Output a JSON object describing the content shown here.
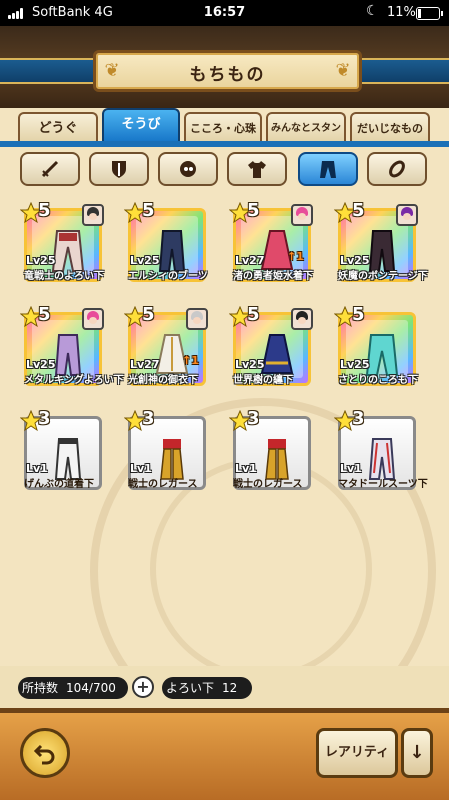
{
  "status": {
    "carrier": "SoftBank  4G",
    "time": "16:57",
    "battery": "11%"
  },
  "header": {
    "title": "もちもの"
  },
  "tabs": [
    {
      "label": "どうぐ"
    },
    {
      "label": "そうび"
    },
    {
      "label": "こころ・心珠"
    },
    {
      "label": "みんなとスタンプ"
    },
    {
      "label": "だいじなもの"
    }
  ],
  "filters": [
    "sword-icon",
    "shield-icon",
    "helmet-icon",
    "shirt-icon",
    "pants-icon",
    "accessory-icon"
  ],
  "items": [
    {
      "rarity": "5",
      "level": "Lv25",
      "name": "竜戦士のよろい下",
      "upgrade": ""
    },
    {
      "rarity": "5",
      "level": "Lv25",
      "name": "エルシィのブーツ",
      "upgrade": ""
    },
    {
      "rarity": "5",
      "level": "Lv27",
      "name": "渚の勇者姫水着下",
      "upgrade": "1"
    },
    {
      "rarity": "5",
      "level": "Lv25",
      "name": "妖魔のボンテージ下",
      "upgrade": ""
    },
    {
      "rarity": "5",
      "level": "Lv25",
      "name": "メタルキングよろい下",
      "upgrade": ""
    },
    {
      "rarity": "5",
      "level": "Lv27",
      "name": "光創神の御衣下",
      "upgrade": "1"
    },
    {
      "rarity": "5",
      "level": "Lv25",
      "name": "世界樹の纏下",
      "upgrade": ""
    },
    {
      "rarity": "5",
      "level": "Lv25",
      "name": "さとりのころも下",
      "upgrade": ""
    },
    {
      "rarity": "3",
      "level": "Lv1",
      "name": "げんぶの道着下",
      "upgrade": ""
    },
    {
      "rarity": "3",
      "level": "Lv1",
      "name": "戦士のレガース",
      "upgrade": ""
    },
    {
      "rarity": "3",
      "level": "Lv1",
      "name": "戦士のレガース",
      "upgrade": ""
    },
    {
      "rarity": "3",
      "level": "Lv1",
      "name": "マタドールスーツ下",
      "upgrade": ""
    }
  ],
  "inventory": {
    "label": "所持数",
    "count": "104/700",
    "plus": "+"
  },
  "category": {
    "label": "よろい下",
    "count": "12"
  },
  "footer": {
    "sort_label": "レアリティ",
    "order_icon": "↓"
  },
  "colors": {
    "tab_active": "#1776c8",
    "rarity5_border": "#f7c337",
    "rarity3_border": "#8a8a8a",
    "footer": "#d08a36"
  }
}
